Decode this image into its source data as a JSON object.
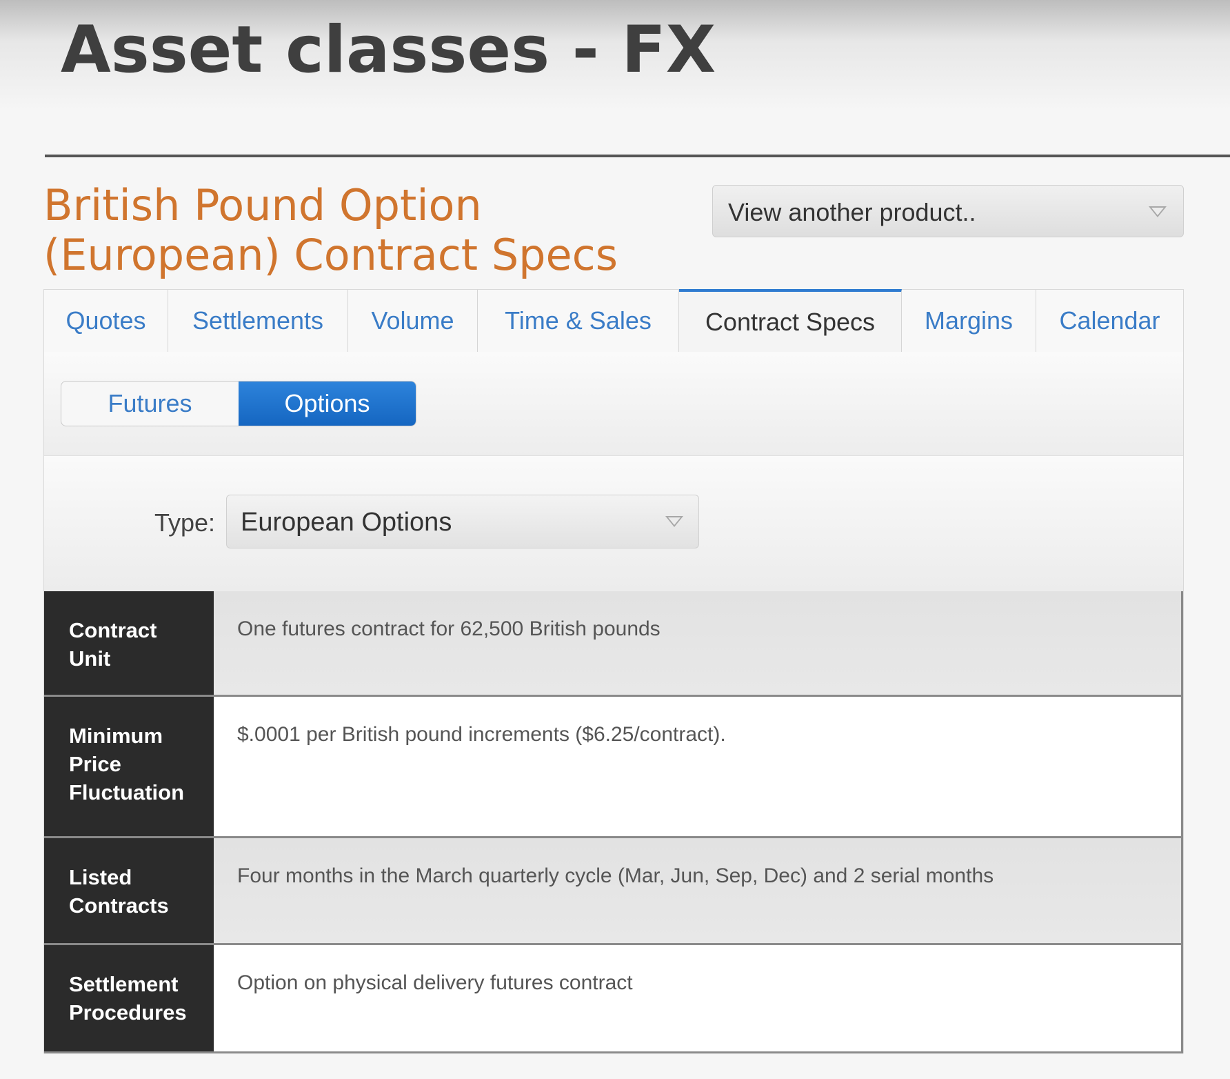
{
  "slide": {
    "title": "Asset classes - FX"
  },
  "product": {
    "title_line1": "British Pound Option",
    "title_line2": "(European) Contract Specs",
    "selector_label": "View another product.."
  },
  "tabs": [
    {
      "label": "Quotes"
    },
    {
      "label": "Settlements"
    },
    {
      "label": "Volume"
    },
    {
      "label": "Time & Sales"
    },
    {
      "label": "Contract Specs",
      "active": true
    },
    {
      "label": "Margins"
    },
    {
      "label": "Calendar"
    }
  ],
  "segment": {
    "futures": "Futures",
    "options": "Options",
    "selected": "Options"
  },
  "type_filter": {
    "label": "Type:",
    "value": "European Options"
  },
  "specs": [
    {
      "key": "Contract Unit",
      "value": "One futures contract for 62,500 British pounds"
    },
    {
      "key": "Minimum Price Fluctuation",
      "value": "$.0001 per British pound increments ($6.25/contract)."
    },
    {
      "key": "Listed Contracts",
      "value": "Four months in the March quarterly cycle (Mar, Jun, Sep, Dec) and 2 serial months"
    },
    {
      "key": "Settlement Procedures",
      "value": "Option on physical delivery futures contract"
    }
  ],
  "colors": {
    "product_title": "#d0752e",
    "tab_link": "#3a7cc7",
    "active_tab_border": "#2f7bd0",
    "selected_segment": "#1f74cf",
    "spec_key_bg": "#2b2b2b"
  }
}
